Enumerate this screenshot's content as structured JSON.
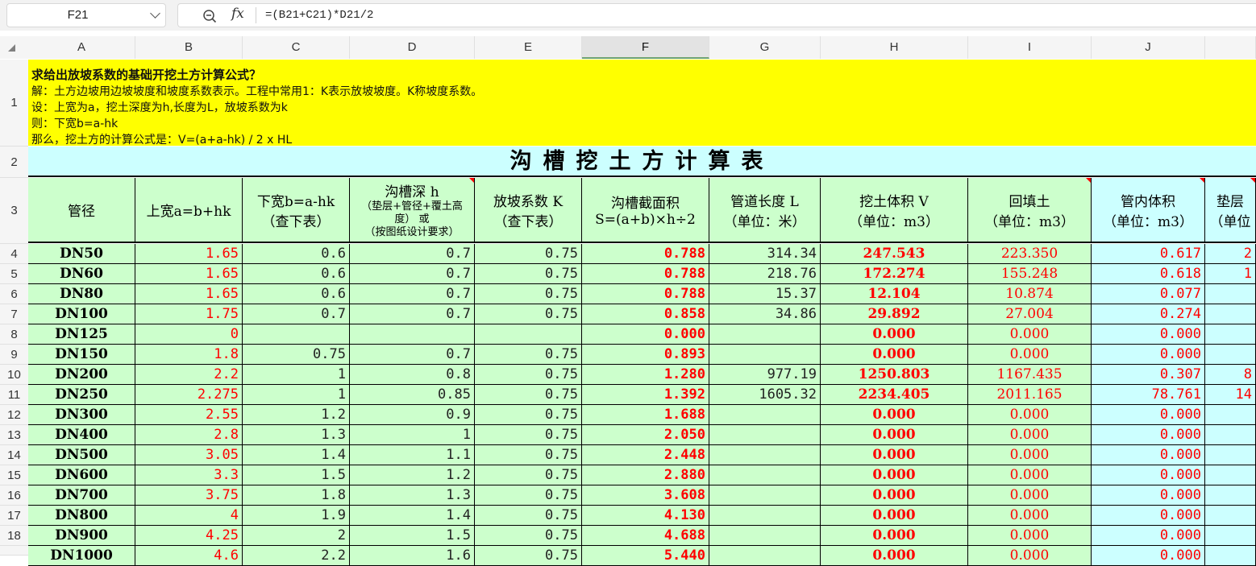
{
  "name_box": "F21",
  "formula": "=(B21+C21)*D21/2",
  "icons": {
    "zoom": "zoom-search-icon",
    "fx": "function-fx-icon",
    "dropdown": "chevron-down-icon"
  },
  "columns": [
    "A",
    "B",
    "C",
    "D",
    "E",
    "F",
    "G",
    "H",
    "I",
    "J",
    ""
  ],
  "selected_column": "F",
  "row_numbers": [
    "1",
    "2",
    "3",
    "4",
    "5",
    "6",
    "7",
    "8",
    "9",
    "10",
    "11",
    "12",
    "13",
    "14",
    "15",
    "16",
    "17",
    "18",
    ""
  ],
  "info": {
    "question": "求给出放坡系数的基础开挖土方计算公式？",
    "line1": "解：土方边坡用边坡坡度和坡度系数表示。工程中常用1：K表示放坡坡度。K称坡度系数。",
    "line2": "设：上宽为a，挖土深度为h,长度为L，放坡系数为k",
    "line3": "则：下宽b=a-hk",
    "line4": "那么，挖土方的计算公式是：V=(a+a-hk) / 2 x HL"
  },
  "table_title": "沟槽挖土方计算表",
  "headers": [
    {
      "l1": "管径"
    },
    {
      "l1": "上宽a=b+hk"
    },
    {
      "l1": "下宽b=a-hk",
      "l2": "（查下表）"
    },
    {
      "l1": "沟槽深 h",
      "s1": "（垫层+管径+覆土高",
      "s2": "度） 或",
      "s3": "（按图纸设计要求）"
    },
    {
      "l1": "放坡系数 K",
      "l2": "（查下表）"
    },
    {
      "l1": "沟槽截面积",
      "l2": "S=(a+b)×h÷2"
    },
    {
      "l1": "管道长度 L",
      "l2": "（单位：米）"
    },
    {
      "l1": "挖土体积 V",
      "l2": "（单位：m3）"
    },
    {
      "l1": "回填土",
      "l2": "（单位：m3）"
    },
    {
      "l1": "管内体积",
      "l2": "（单位：m3）"
    },
    {
      "l1": "垫层",
      "l2": "（单位"
    }
  ],
  "rows": [
    {
      "pipe": "DN50",
      "a": "1.65",
      "b": "0.6",
      "h": "0.7",
      "k": "0.75",
      "s": "0.788",
      "l": "314.34",
      "v": "247.543",
      "fill": "223.350",
      "inner": "0.617",
      "pad": "2"
    },
    {
      "pipe": "DN60",
      "a": "1.65",
      "b": "0.6",
      "h": "0.7",
      "k": "0.75",
      "s": "0.788",
      "l": "218.76",
      "v": "172.274",
      "fill": "155.248",
      "inner": "0.618",
      "pad": "1"
    },
    {
      "pipe": "DN80",
      "a": "1.65",
      "b": "0.6",
      "h": "0.7",
      "k": "0.75",
      "s": "0.788",
      "l": "15.37",
      "v": "12.104",
      "fill": "10.874",
      "inner": "0.077",
      "pad": ""
    },
    {
      "pipe": "DN100",
      "a": "1.75",
      "b": "0.7",
      "h": "0.7",
      "k": "0.75",
      "s": "0.858",
      "l": "34.86",
      "v": "29.892",
      "fill": "27.004",
      "inner": "0.274",
      "pad": ""
    },
    {
      "pipe": "DN125",
      "a": "0",
      "b": "",
      "h": "",
      "k": "",
      "s": "0.000",
      "l": "",
      "v": "0.000",
      "fill": "0.000",
      "inner": "0.000",
      "pad": ""
    },
    {
      "pipe": "DN150",
      "a": "1.8",
      "b": "0.75",
      "h": "0.7",
      "k": "0.75",
      "s": "0.893",
      "l": "",
      "v": "0.000",
      "fill": "0.000",
      "inner": "0.000",
      "pad": ""
    },
    {
      "pipe": "DN200",
      "a": "2.2",
      "b": "1",
      "h": "0.8",
      "k": "0.75",
      "s": "1.280",
      "l": "977.19",
      "v": "1250.803",
      "fill": "1167.435",
      "inner": "0.307",
      "pad": "8"
    },
    {
      "pipe": "DN250",
      "a": "2.275",
      "b": "1",
      "h": "0.85",
      "k": "0.75",
      "s": "1.392",
      "l": "1605.32",
      "v": "2234.405",
      "fill": "2011.165",
      "inner": "78.761",
      "pad": "14"
    },
    {
      "pipe": "DN300",
      "a": "2.55",
      "b": "1.2",
      "h": "0.9",
      "k": "0.75",
      "s": "1.688",
      "l": "",
      "v": "0.000",
      "fill": "0.000",
      "inner": "0.000",
      "pad": ""
    },
    {
      "pipe": "DN400",
      "a": "2.8",
      "b": "1.3",
      "h": "1",
      "k": "0.75",
      "s": "2.050",
      "l": "",
      "v": "0.000",
      "fill": "0.000",
      "inner": "0.000",
      "pad": ""
    },
    {
      "pipe": "DN500",
      "a": "3.05",
      "b": "1.4",
      "h": "1.1",
      "k": "0.75",
      "s": "2.448",
      "l": "",
      "v": "0.000",
      "fill": "0.000",
      "inner": "0.000",
      "pad": ""
    },
    {
      "pipe": "DN600",
      "a": "3.3",
      "b": "1.5",
      "h": "1.2",
      "k": "0.75",
      "s": "2.880",
      "l": "",
      "v": "0.000",
      "fill": "0.000",
      "inner": "0.000",
      "pad": ""
    },
    {
      "pipe": "DN700",
      "a": "3.75",
      "b": "1.8",
      "h": "1.3",
      "k": "0.75",
      "s": "3.608",
      "l": "",
      "v": "0.000",
      "fill": "0.000",
      "inner": "0.000",
      "pad": ""
    },
    {
      "pipe": "DN800",
      "a": "4",
      "b": "1.9",
      "h": "1.4",
      "k": "0.75",
      "s": "4.130",
      "l": "",
      "v": "0.000",
      "fill": "0.000",
      "inner": "0.000",
      "pad": ""
    },
    {
      "pipe": "DN900",
      "a": "4.25",
      "b": "2",
      "h": "1.5",
      "k": "0.75",
      "s": "4.688",
      "l": "",
      "v": "0.000",
      "fill": "0.000",
      "inner": "0.000",
      "pad": ""
    },
    {
      "pipe": "DN1000",
      "a": "4.6",
      "b": "2.2",
      "h": "1.6",
      "k": "0.75",
      "s": "5.440",
      "l": "",
      "v": "0.000",
      "fill": "0.000",
      "inner": "0.000",
      "pad": ""
    }
  ],
  "colors": {
    "info_bg": "#ffff00",
    "title_bg": "#ccffff",
    "green_cell": "#ccffcc",
    "blue_cell": "#ccffff",
    "red_text": "#ff0000",
    "selected_col_border": "#6fa36f"
  }
}
